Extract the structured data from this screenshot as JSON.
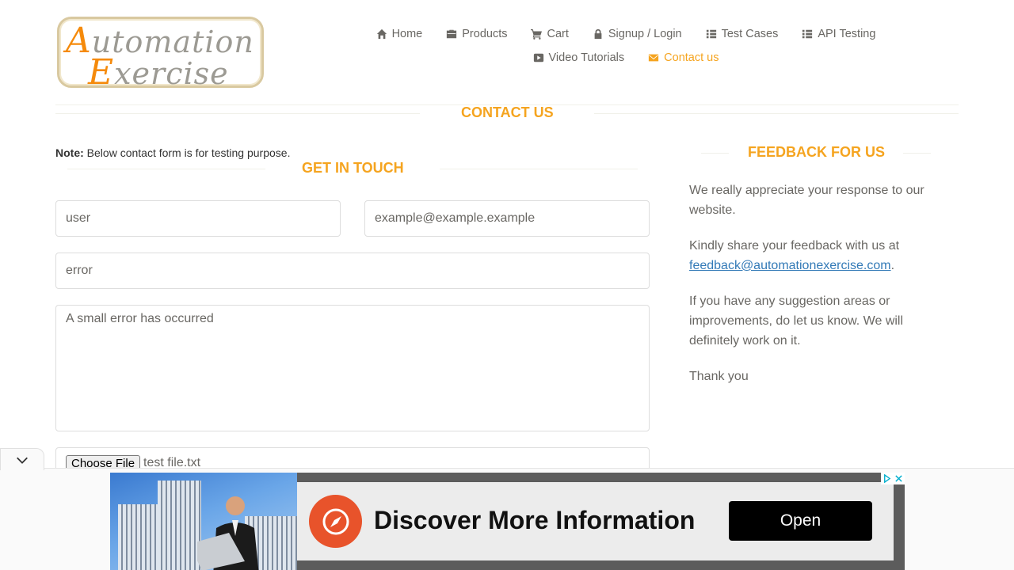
{
  "logo": {
    "line1_cap": "A",
    "line1_rest": "utomation",
    "line2_cap": "E",
    "line2_rest": "xercise"
  },
  "nav": {
    "row1": [
      {
        "label": "Home",
        "icon": "home-icon"
      },
      {
        "label": "Products",
        "icon": "briefcase-icon"
      },
      {
        "label": "Cart",
        "icon": "cart-icon"
      },
      {
        "label": "Signup / Login",
        "icon": "lock-icon"
      },
      {
        "label": "Test Cases",
        "icon": "list-icon"
      },
      {
        "label": "API Testing",
        "icon": "list-icon"
      }
    ],
    "row2": [
      {
        "label": "Video Tutorials",
        "icon": "youtube-icon"
      },
      {
        "label": "Contact us",
        "icon": "envelope-icon",
        "active": true
      }
    ]
  },
  "contact_title": "CONTACT US",
  "note": {
    "bold": "Note:",
    "text": " Below contact form is for testing purpose."
  },
  "get_in_touch": "GET IN TOUCH",
  "form": {
    "name_value": "user",
    "email_value": "example@example.example",
    "subject_value": "error",
    "message_value": "A small error has occurred",
    "file_button": "Choose File",
    "file_name": "test  file.txt"
  },
  "feedback": {
    "title": "FEEDBACK FOR US",
    "p1": "We really appreciate your response to our website.",
    "p2_before": "Kindly share your feedback with us at ",
    "p2_link": "feedback@automationexercise.com",
    "p2_after": ".",
    "p3": "If you have any suggestion areas or improvements, do let us know. We will definitely work on it.",
    "p4": "Thank you"
  },
  "ad": {
    "headline": "Discover More Information",
    "button": "Open"
  },
  "colors": {
    "accent": "#F5A41F",
    "text": "#696763",
    "link": "#337AB7"
  }
}
